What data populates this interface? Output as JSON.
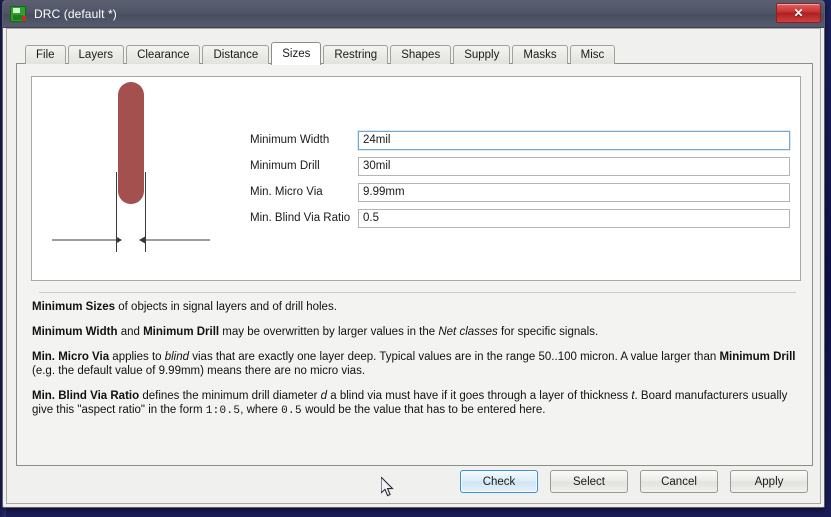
{
  "window": {
    "title": "DRC (default *)",
    "icon": "chip-save-icon",
    "close_label": "✕"
  },
  "tabs": [
    {
      "label": "File",
      "active": false
    },
    {
      "label": "Layers",
      "active": false
    },
    {
      "label": "Clearance",
      "active": false
    },
    {
      "label": "Distance",
      "active": false
    },
    {
      "label": "Sizes",
      "active": true
    },
    {
      "label": "Restring",
      "active": false
    },
    {
      "label": "Shapes",
      "active": false
    },
    {
      "label": "Supply",
      "active": false
    },
    {
      "label": "Masks",
      "active": false
    },
    {
      "label": "Misc",
      "active": false
    }
  ],
  "form": {
    "fields": [
      {
        "label": "Minimum Width",
        "value": "24mil",
        "focused": true
      },
      {
        "label": "Minimum Drill",
        "value": "30mil",
        "focused": false
      },
      {
        "label": "Min. Micro Via",
        "value": "9.99mm",
        "focused": false
      },
      {
        "label": "Min. Blind Via Ratio",
        "value": "0.5",
        "focused": false
      }
    ]
  },
  "illustration": {
    "name": "minimum-width-diagram",
    "bar_color": "#a4504f",
    "line_color": "#3a3a3a"
  },
  "description": {
    "p1": {
      "bold1": "Minimum Sizes",
      "rest": " of objects in signal layers and of drill holes."
    },
    "p2": {
      "bold1": "Minimum Width",
      "mid1": " and ",
      "bold2": "Minimum Drill",
      "mid2": " may be overwritten by larger values in the ",
      "italic1": "Net classes",
      "rest": " for specific signals."
    },
    "p3": {
      "bold1": "Min. Micro Via",
      "mid1": " applies to ",
      "italic1": "blind",
      "mid2": " vias that are exactly one layer deep. Typical values are in the range 50..100 micron. A value larger than ",
      "bold2": "Minimum Drill",
      "rest": " (e.g. the default value of 9.99mm) means there are no micro vias."
    },
    "p4": {
      "bold1": "Min. Blind Via Ratio",
      "mid1": " defines the minimum drill diameter ",
      "italic1": "d",
      "mid2": " a blind via must have if it goes through a layer of thickness ",
      "italic2": "t",
      "mid3": ". Board manufacturers usually give this \"aspect ratio\" in the form ",
      "mono1": "1:0.5",
      "mid4": ", where ",
      "mono2": "0.5",
      "rest": " would be the value that has to be entered here."
    }
  },
  "buttons": [
    {
      "label": "Check",
      "default": true
    },
    {
      "label": "Select",
      "default": false
    },
    {
      "label": "Cancel",
      "default": false
    },
    {
      "label": "Apply",
      "default": false
    }
  ]
}
